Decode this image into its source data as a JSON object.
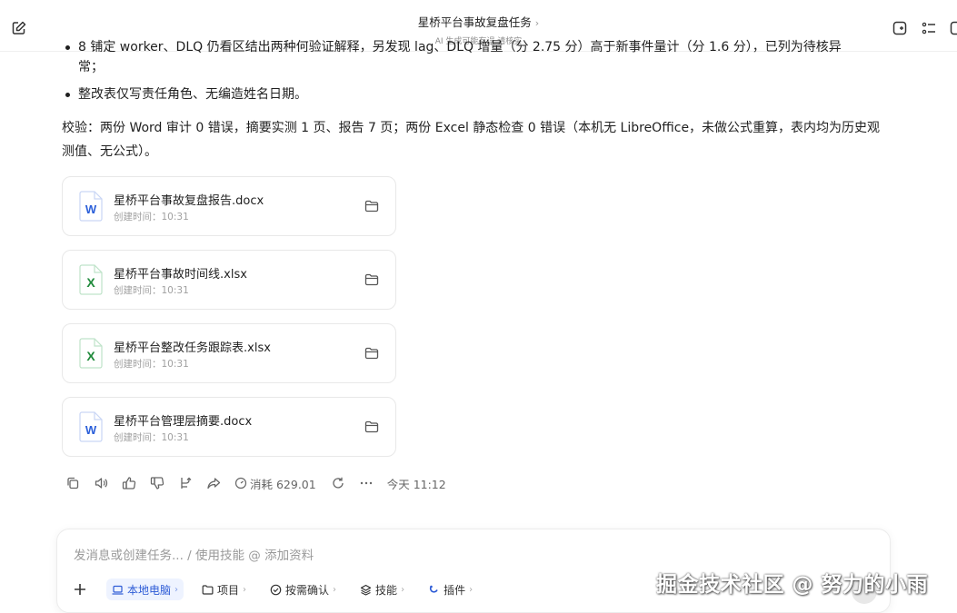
{
  "header": {
    "title": "星桥平台事故复盘任务",
    "title_chevron": "›",
    "subtitle": "AI 生成可能有误 请核实"
  },
  "content": {
    "clipped_line": "8 铺定 worker、DLQ 仍看区结出两种何验证解释，另发现 lag、DLQ 增量（分 2.75 分）高于新事件量计（分 1.6 分），已列为待核异",
    "clipped_line_cont": "常；",
    "bullet_item": "整改表仅写责任角色、无编造姓名日期。",
    "verify_text": "校验：两份 Word 审计 0 错误，摘要实测 1 页、报告 7 页；两份 Excel 静态检查 0 错误（本机无 LibreOffice，未做公式重算，表内均为历史观测值、无公式）。"
  },
  "files": [
    {
      "name": "星桥平台事故复盘报告.docx",
      "time": "创建时间：10:31",
      "type": "word"
    },
    {
      "name": "星桥平台事故时间线.xlsx",
      "time": "创建时间：10:31",
      "type": "excel"
    },
    {
      "name": "星桥平台整改任务跟踪表.xlsx",
      "time": "创建时间：10:31",
      "type": "excel"
    },
    {
      "name": "星桥平台管理层摘要.docx",
      "time": "创建时间：10:31",
      "type": "word"
    }
  ],
  "actions": {
    "cost": "消耗 629.01",
    "time": "今天 11:12"
  },
  "input": {
    "placeholder": "发消息或创建任务... / 使用技能 @ 添加资料",
    "chips": [
      {
        "label": "本地电脑",
        "active": true
      },
      {
        "label": "项目",
        "active": false
      },
      {
        "label": "按需确认",
        "active": false
      },
      {
        "label": "技能",
        "active": false
      },
      {
        "label": "插件",
        "active": false
      }
    ],
    "chip_chevron": "›"
  },
  "watermark": "掘金技术社区 @ 努力的小雨",
  "colors": {
    "word_blue": "#2b5fd9",
    "excel_green": "#1f8a3b",
    "accent": "#2d5bd6"
  }
}
